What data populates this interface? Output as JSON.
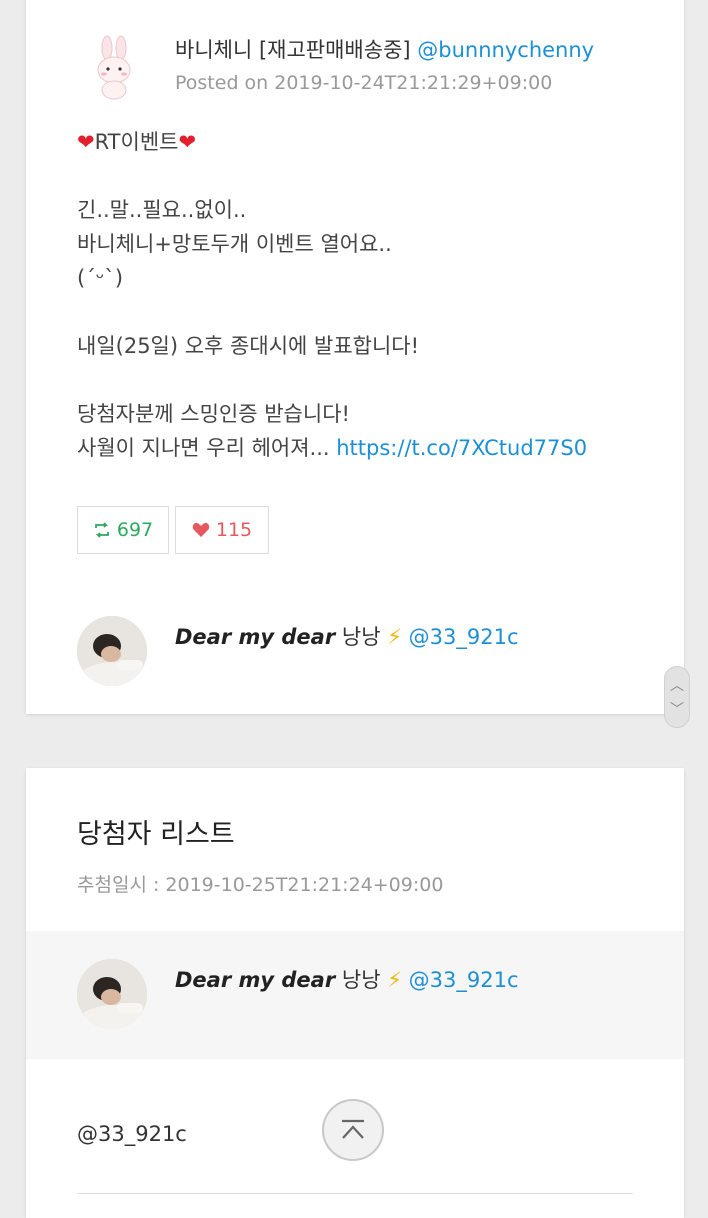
{
  "tweet": {
    "author_name": "바니체니 [재고판매배송중]",
    "author_handle": "@bunnnychenny",
    "posted": "Posted on 2019-10-24T21:21:29+09:00",
    "body": {
      "line1": "RT이벤트",
      "line2": "긴..말..필요..없이..",
      "line3": "바니체니+망토두개 이벤트 열어요..",
      "line4": "(ˊᵕˋ)",
      "line5": "내일(25일) 오후 종대시에 발표합니다!",
      "line6": "당첨자분께 스밍인증 받습니다!",
      "line7_text": "사월이 지나면 우리 헤어져... ",
      "line7_link": "https://t.co/7XCtud77S0"
    },
    "retweets": "697",
    "likes": "115"
  },
  "participant": {
    "name": "Dear my dear",
    "suffix": " 낭낭 ",
    "handle": "@33_921c"
  },
  "winner_list": {
    "title": "당첨자 리스트",
    "draw_time": "추첨일시 : 2019-10-25T21:21:24+09:00",
    "winner_name": "Dear my dear",
    "winner_suffix": " 낭낭 ",
    "winner_handle": "@33_921c",
    "handle_text": "@33_921c"
  },
  "colors": {
    "link": "#1d8fd4",
    "retweet": "#2ea85c",
    "like": "#e5595c",
    "background": "#ececec"
  },
  "icons": {
    "retweet": "retweet-icon",
    "like": "heart-icon",
    "bolt": "lightning-icon",
    "top": "scroll-top-icon"
  }
}
